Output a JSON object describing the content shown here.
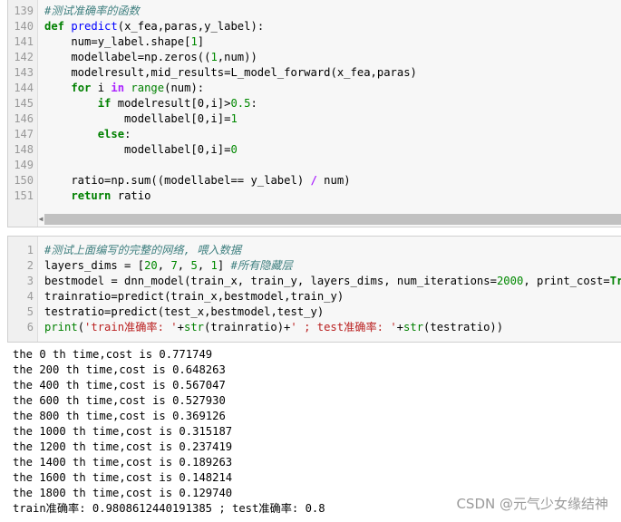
{
  "cell1": {
    "lines": [
      {
        "n": "139",
        "segs": [
          [
            "cm",
            "#测试准确率的函数"
          ]
        ]
      },
      {
        "n": "140",
        "segs": [
          [
            "kw",
            "def "
          ],
          [
            "fn",
            "predict"
          ],
          [
            "",
            "(x_fea,paras,y_label):"
          ]
        ]
      },
      {
        "n": "141",
        "segs": [
          [
            "",
            "    num=y_label.shape["
          ],
          [
            "num",
            "1"
          ],
          [
            "",
            "]"
          ]
        ]
      },
      {
        "n": "142",
        "segs": [
          [
            "",
            "    modellabel=np.zeros(("
          ],
          [
            "num",
            "1"
          ],
          [
            "",
            ",num))"
          ]
        ]
      },
      {
        "n": "143",
        "segs": [
          [
            "",
            "    modelresult,mid_results=L_model_forward(x_fea,paras)"
          ]
        ]
      },
      {
        "n": "144",
        "segs": [
          [
            "",
            "    "
          ],
          [
            "kw",
            "for"
          ],
          [
            "",
            " i "
          ],
          [
            "op",
            "in"
          ],
          [
            "",
            " "
          ],
          [
            "bi",
            "range"
          ],
          [
            "",
            "(num):"
          ]
        ]
      },
      {
        "n": "145",
        "segs": [
          [
            "",
            "        "
          ],
          [
            "kw",
            "if"
          ],
          [
            "",
            " modelresult[0,i]>"
          ],
          [
            "num",
            "0.5"
          ],
          [
            "",
            ":"
          ]
        ]
      },
      {
        "n": "146",
        "segs": [
          [
            "",
            "            modellabel[0,i]="
          ],
          [
            "num",
            "1"
          ]
        ]
      },
      {
        "n": "147",
        "segs": [
          [
            "",
            "        "
          ],
          [
            "kw",
            "else"
          ],
          [
            "",
            ":"
          ]
        ]
      },
      {
        "n": "148",
        "segs": [
          [
            "",
            "            modellabel[0,i]="
          ],
          [
            "num",
            "0"
          ]
        ]
      },
      {
        "n": "149",
        "segs": [
          [
            "",
            ""
          ]
        ]
      },
      {
        "n": "150",
        "segs": [
          [
            "",
            "    ratio=np.sum((modellabel== y_label) "
          ],
          [
            "op",
            "/"
          ],
          [
            "",
            " num)"
          ]
        ]
      },
      {
        "n": "151",
        "segs": [
          [
            "",
            "    "
          ],
          [
            "kw",
            "return"
          ],
          [
            "",
            " ratio"
          ]
        ]
      }
    ]
  },
  "cell2": {
    "lines": [
      {
        "n": "1",
        "segs": [
          [
            "cm",
            "#测试上面编写的完整的网络, 喂入数据"
          ]
        ]
      },
      {
        "n": "2",
        "segs": [
          [
            "",
            "layers_dims = ["
          ],
          [
            "num",
            "20"
          ],
          [
            "",
            ", "
          ],
          [
            "num",
            "7"
          ],
          [
            "",
            ", "
          ],
          [
            "num",
            "5"
          ],
          [
            "",
            ", "
          ],
          [
            "num",
            "1"
          ],
          [
            "",
            "] "
          ],
          [
            "cm",
            "#所有隐藏层"
          ]
        ]
      },
      {
        "n": "3",
        "segs": [
          [
            "",
            "bestmodel = dnn_model(train_x, train_y, layers_dims, num_iterations="
          ],
          [
            "num",
            "2000"
          ],
          [
            "",
            ", print_cost="
          ],
          [
            "kw",
            "True"
          ],
          [
            "",
            ")"
          ]
        ]
      },
      {
        "n": "4",
        "segs": [
          [
            "",
            "trainratio=predict(train_x,bestmodel,train_y)"
          ]
        ]
      },
      {
        "n": "5",
        "segs": [
          [
            "",
            "testratio=predict(test_x,bestmodel,test_y)"
          ]
        ]
      },
      {
        "n": "6",
        "segs": [
          [
            "bi",
            "print"
          ],
          [
            "",
            "("
          ],
          [
            "st",
            "'train准确率: '"
          ],
          [
            "",
            "+"
          ],
          [
            "bi",
            "str"
          ],
          [
            "",
            "(trainratio)+"
          ],
          [
            "st",
            "' ; test准确率: '"
          ],
          [
            "",
            "+"
          ],
          [
            "bi",
            "str"
          ],
          [
            "",
            "(testratio))"
          ]
        ]
      }
    ]
  },
  "output": [
    "the 0 th time,cost is 0.771749",
    "the 200 th time,cost is 0.648263",
    "the 400 th time,cost is 0.567047",
    "the 600 th time,cost is 0.527930",
    "the 800 th time,cost is 0.369126",
    "the 1000 th time,cost is 0.315187",
    "the 1200 th time,cost is 0.237419",
    "the 1400 th time,cost is 0.189263",
    "the 1600 th time,cost is 0.148214",
    "the 1800 th time,cost is 0.129740",
    "train准确率: 0.9808612440191385 ; test准确率: 0.8"
  ],
  "watermark": "CSDN @元气少女缘结神"
}
